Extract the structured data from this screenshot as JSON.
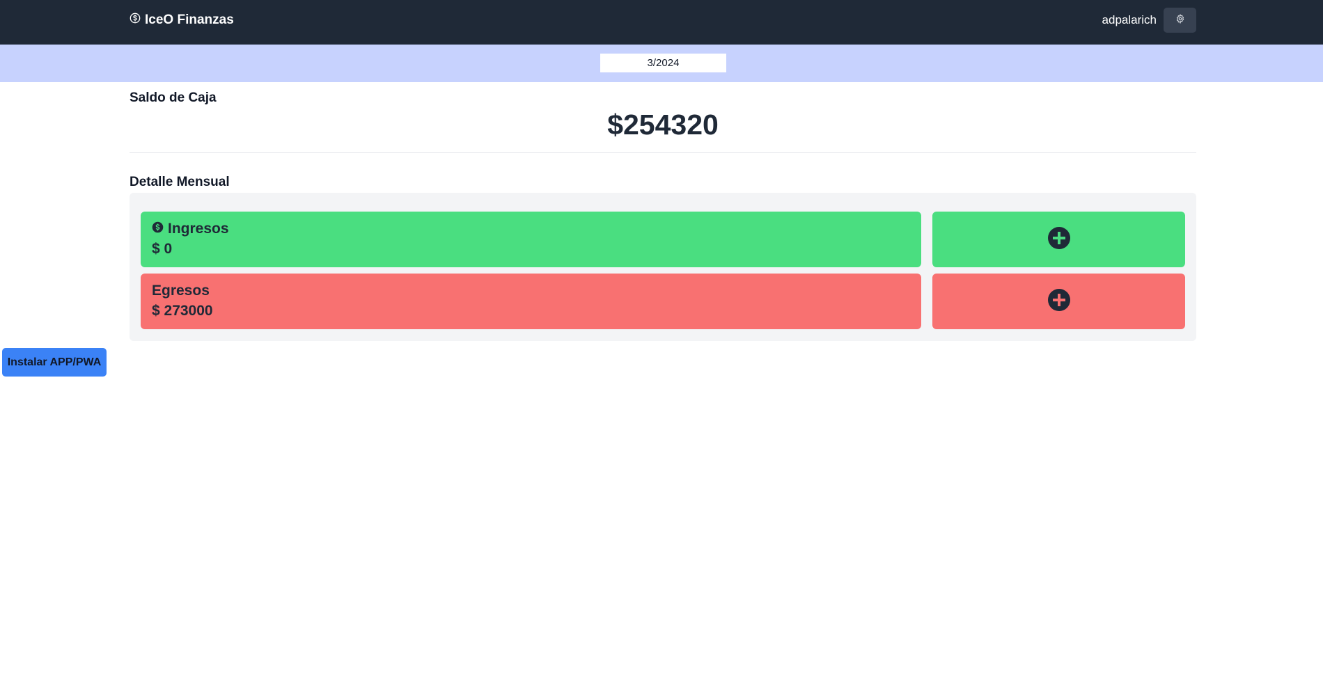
{
  "navbar": {
    "brand_icon": "dollar-circle-icon",
    "brand": "IceO Finanzas",
    "username": "adpalarich",
    "settings_icon": "gear-icon"
  },
  "period": {
    "value": "3/2024"
  },
  "balance_section": {
    "title": "Saldo de Caja",
    "amount": "$254320"
  },
  "monthly_section": {
    "title": "Detalle Mensual",
    "rows": [
      {
        "label": "Ingresos",
        "icon": "dollar-circle-icon",
        "amount": "$ 0",
        "color": "#4ade80",
        "add_icon": "plus-circle-icon"
      },
      {
        "label": "Egresos",
        "amount": "$ 273000",
        "color": "#f87171",
        "add_icon": "plus-circle-icon"
      }
    ]
  },
  "install_button": {
    "label": "Instalar APP/PWA"
  },
  "colors": {
    "navbar": "#1f2937",
    "period_bar": "#c7d2fe",
    "income": "#4ade80",
    "expense": "#f87171",
    "install": "#3b82f6"
  }
}
